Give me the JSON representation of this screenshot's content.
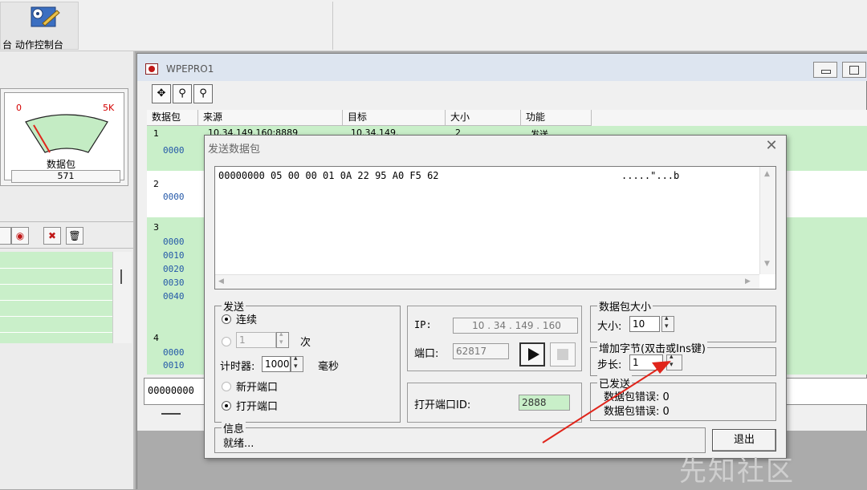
{
  "toolbar": {
    "label": "台 动作控制台"
  },
  "gauge": {
    "min_label": "0",
    "max_label": "5K",
    "caption": "数据包",
    "count": "571"
  },
  "window": {
    "title": "WPEPRO1"
  },
  "grid": {
    "columns": [
      "数据包",
      "来源",
      "目标",
      "大小",
      "功能"
    ],
    "rows": [
      {
        "num": "1",
        "source": "10.34.149.160:8889",
        "target": "10.34.149.",
        "size": "2",
        "func": "发送",
        "offsets": [
          "0000"
        ]
      },
      {
        "num": "2",
        "offsets": [
          "0000"
        ]
      },
      {
        "num": "3",
        "offsets": [
          "0000",
          "0010",
          "0020",
          "0030",
          "0040"
        ]
      },
      {
        "num": "4",
        "offsets": [
          "0000",
          "0010"
        ]
      }
    ],
    "hex_line": "00000000"
  },
  "dialog": {
    "title": "发送数据包",
    "hex_line": "00000000 05 00 00 01 0A 22 95 A0 F5 62",
    "ascii_line": ".....\"...b",
    "send": {
      "title": "发送",
      "continuous": "连续",
      "count_value": "1",
      "count_unit": "次",
      "timer_label": "计时器:",
      "timer_value": "1000",
      "timer_unit": "毫秒",
      "new_port": "新开端口",
      "open_port": "打开端口"
    },
    "ip": {
      "label": "IP:",
      "value": "10 . 34 . 149 . 160"
    },
    "port": {
      "label": "端口:",
      "value": "62817"
    },
    "open_port_id": {
      "label": "打开端口ID:",
      "value": "2888"
    },
    "size": {
      "title": "数据包大小",
      "label": "大小:",
      "value": "10"
    },
    "increment": {
      "title": "增加字节(双击或Ins键)",
      "label": "步长:",
      "value": "1"
    },
    "sent": {
      "title": "已发送",
      "err1": "数据包错误: 0",
      "err2": "数据包错误: 0"
    },
    "info": {
      "title": "信息",
      "status": "就绪..."
    },
    "exit_label": "退出"
  },
  "watermark": "先知社区",
  "colors": {
    "band_green": "#c9efc9",
    "accent_red": "#e0251b"
  }
}
